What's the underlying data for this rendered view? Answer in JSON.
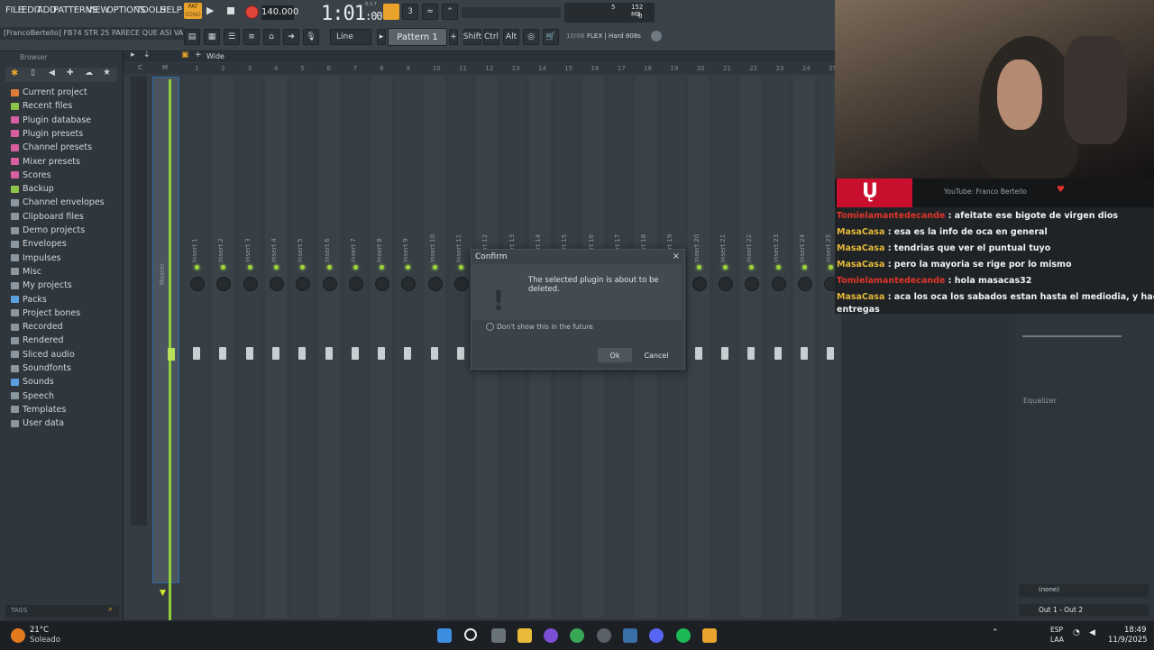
{
  "menu": [
    "FILE",
    "EDIT",
    "ADD",
    "PATTERNS",
    "VIEW",
    "OPTIONS",
    "TOOLS",
    "HELP"
  ],
  "transport": {
    "pat_label": "PAT",
    "song_label": "SONG",
    "tempo": "140.000",
    "time": "1:01",
    "time_sub": ":00",
    "bst_label": "B:S:T",
    "cpu_value": "5",
    "memory": "152 MB",
    "poly": "0"
  },
  "title_bar": "[FrancoBertello] FB74 STR 25 PARECE QUE ASI VA.flp",
  "toolbar": {
    "snap_mode": "Line",
    "pattern": "Pattern 1",
    "shift": "Shift",
    "ctrl": "Ctrl",
    "alt": "Alt",
    "hint_date": "10/08",
    "hint_text": "FLEX | Hard 808s"
  },
  "browser": {
    "title": "Browser",
    "tags_label": "TAGS",
    "items": [
      {
        "label": "Current project",
        "color": "#e07a3a"
      },
      {
        "label": "Recent files",
        "color": "#8fc24a"
      },
      {
        "label": "Plugin database",
        "color": "#d75fa0"
      },
      {
        "label": "Plugin presets",
        "color": "#d75fa0"
      },
      {
        "label": "Channel presets",
        "color": "#d75fa0"
      },
      {
        "label": "Mixer presets",
        "color": "#d75fa0"
      },
      {
        "label": "Scores",
        "color": "#d75fa0"
      },
      {
        "label": "Backup",
        "color": "#8fc24a"
      },
      {
        "label": "Channel envelopes",
        "color": "#8a97a0"
      },
      {
        "label": "Clipboard files",
        "color": "#8a97a0"
      },
      {
        "label": "Demo projects",
        "color": "#8a97a0"
      },
      {
        "label": "Envelopes",
        "color": "#8a97a0"
      },
      {
        "label": "Impulses",
        "color": "#8a97a0"
      },
      {
        "label": "Misc",
        "color": "#8a97a0"
      },
      {
        "label": "My projects",
        "color": "#8a97a0"
      },
      {
        "label": "Packs",
        "color": "#5aa0e0"
      },
      {
        "label": "Project bones",
        "color": "#8a97a0"
      },
      {
        "label": "Recorded",
        "color": "#8a97a0"
      },
      {
        "label": "Rendered",
        "color": "#8a97a0"
      },
      {
        "label": "Sliced audio",
        "color": "#8a97a0"
      },
      {
        "label": "Soundfonts",
        "color": "#8a97a0"
      },
      {
        "label": "Sounds",
        "color": "#5aa0e0"
      },
      {
        "label": "Speech",
        "color": "#8a97a0"
      },
      {
        "label": "Templates",
        "color": "#8a97a0"
      },
      {
        "label": "User data",
        "color": "#8a97a0"
      }
    ]
  },
  "mixer": {
    "mode": "Wide",
    "master_label": "Master",
    "inserts": [
      "Insert 1",
      "Insert 2",
      "Insert 3",
      "Insert 4",
      "Insert 5",
      "Insert 6",
      "Insert 7",
      "Insert 8",
      "Insert 9",
      "Insert 10",
      "Insert 11",
      "Insert 12",
      "Insert 13",
      "Insert 14",
      "Insert 15",
      "Insert 16",
      "Insert 17",
      "Insert 18",
      "Insert 19",
      "Insert 20",
      "Insert 21",
      "Insert 22",
      "Insert 23",
      "Insert 24",
      "Insert 25"
    ],
    "numbers": [
      "1",
      "2",
      "3",
      "4",
      "5",
      "6",
      "7",
      "8",
      "9",
      "10",
      "11",
      "12",
      "13",
      "14",
      "15",
      "16",
      "17",
      "18",
      "19",
      "20",
      "21",
      "22",
      "23",
      "24",
      "25"
    ],
    "header_c": "C",
    "header_m": "M",
    "equalizer_label": "Equalizer",
    "slot_none": "(none)",
    "output": "Out 1 - Out 2"
  },
  "dialog": {
    "title": "Confirm",
    "close": "×",
    "message": "The selected plugin is about to be deleted.",
    "icon": "!",
    "checkbox_label": "Don't show this in the future",
    "ok": "Ok",
    "cancel": "Cancel"
  },
  "stream": {
    "banner": "YouTube: Franco Bertello",
    "chat": [
      {
        "user": "Tomielamantedecande",
        "text": " : afeitate ese bigote de virgen dios",
        "color": "red"
      },
      {
        "user": "MasaCasa",
        "text": " : esa es la info de oca en general",
        "color": "yellow"
      },
      {
        "user": "MasaCasa",
        "text": " : tendrias que ver el puntual tuyo",
        "color": "yellow"
      },
      {
        "user": "MasaCasa",
        "text": " : pero la mayoria se rige por lo mismo",
        "color": "yellow"
      },
      {
        "user": "Tomielamantedecande",
        "text": " : hola masacas32",
        "color": "red"
      },
      {
        "user": "MasaCasa",
        "text": " : aca los oca los sabados estan hasta el mediodia, y hacen",
        "color": "yellow"
      }
    ],
    "chat_wrap": "entregas"
  },
  "taskbar": {
    "temp": "21°C",
    "weather": "Soleado",
    "lang": "ESP",
    "lang2": "LAA",
    "time": "18:49",
    "date": "11/9/2025"
  }
}
